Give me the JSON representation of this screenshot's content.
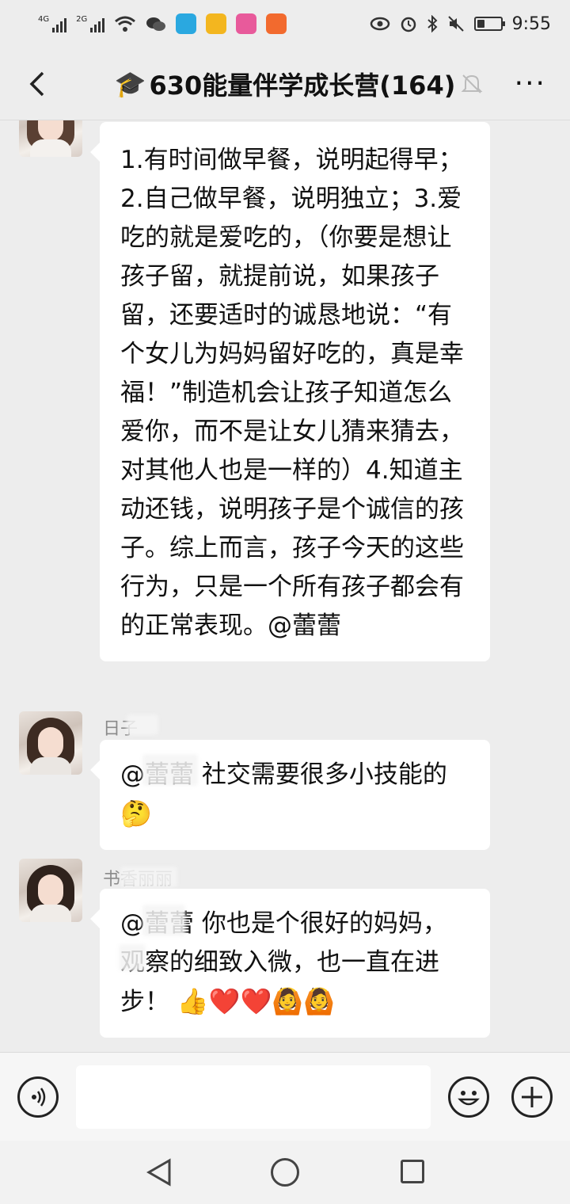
{
  "status_bar": {
    "sig1_label": "4G",
    "sig2_label": "2G",
    "time": "9:55"
  },
  "header": {
    "title_emoji": "🎓",
    "title": "630能量伴学成长营(164)"
  },
  "messages": [
    {
      "text": "1.有时间做早餐，说明起得早；2.自己做早餐，说明独立；3.爱吃的就是爱吃的，（你要是想让孩子留，就提前说，如果孩子留，还要适时的诚恳地说：“有个女儿为妈妈留好吃的，真是幸福！”制造机会让孩子知道怎么爱你，而不是让女儿猜来猜去，对其他人也是一样的）4.知道主动还钱，说明孩子是个诚信的孩子。综上而言，孩子今天的这些行为，只是一个所有孩子都会有的正常表现。@蕾蕾"
    },
    {
      "sender": "日子",
      "text": "@蕾蕾  社交需要很多小技能的",
      "emoji": "🤔"
    },
    {
      "sender": "书香丽丽",
      "text": "@蕾蕾  你也是个很好的妈妈，观察的细致入微，也一直在进步！",
      "emoji": "👍❤️❤️🙆🙆"
    }
  ],
  "input_bar": {
    "placeholder": ""
  }
}
